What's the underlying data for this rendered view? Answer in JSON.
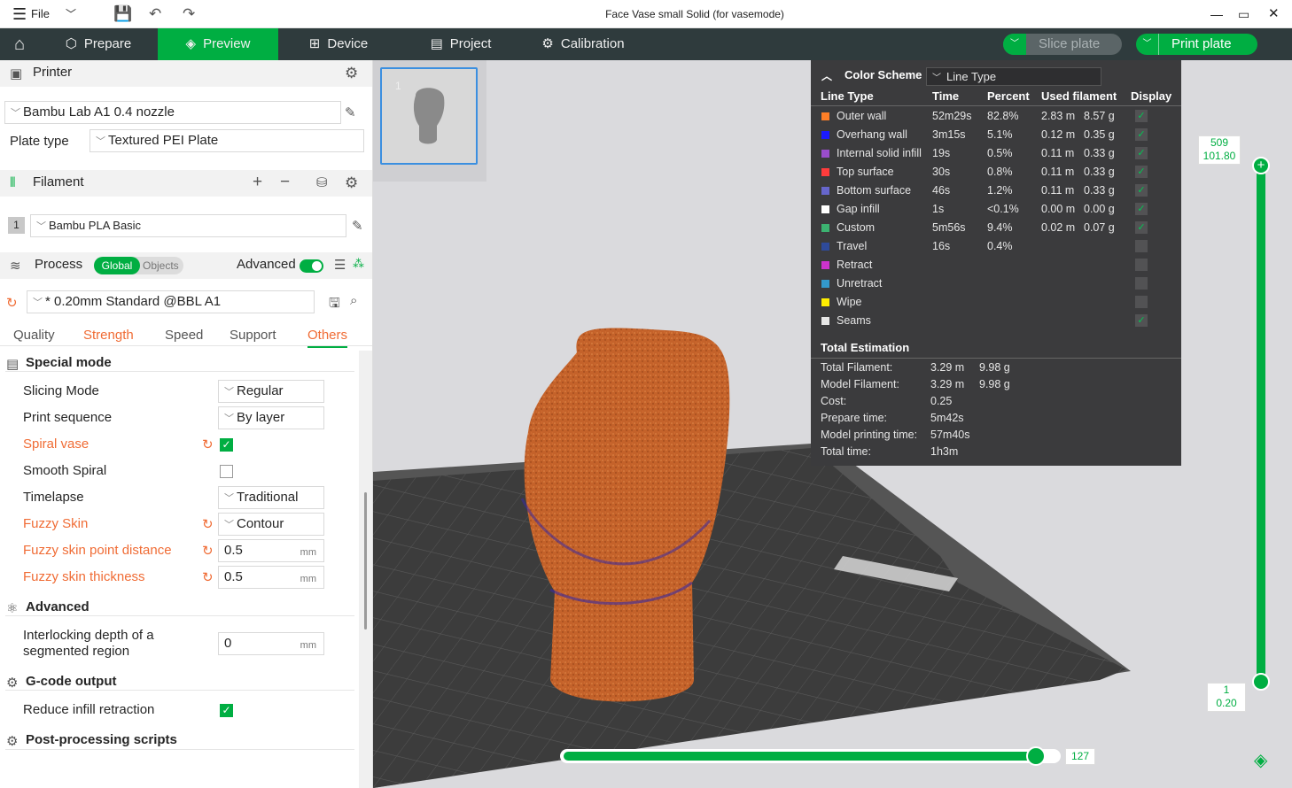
{
  "titlebar": {
    "title": "Face Vase small Solid (for vasemode)",
    "file_label": "File",
    "icons": [
      "menu-icon",
      "chevron-down-icon",
      "save-icon",
      "undo-icon",
      "redo-icon",
      "minimize-icon",
      "maximize-icon",
      "close-icon"
    ]
  },
  "nav": {
    "tabs": [
      {
        "label": "Prepare",
        "icon": "cube-icon"
      },
      {
        "label": "Preview",
        "icon": "layers-icon"
      },
      {
        "label": "Device",
        "icon": "device-icon"
      },
      {
        "label": "Project",
        "icon": "project-icon"
      },
      {
        "label": "Calibration",
        "icon": "calibration-icon"
      }
    ],
    "active_tab": "Preview",
    "slice_label": "Slice plate",
    "print_label": "Print plate"
  },
  "printer": {
    "section_label": "Printer",
    "name": "Bambu Lab A1 0.4 nozzle",
    "plate_type_label": "Plate type",
    "plate_type": "Textured PEI Plate"
  },
  "filament": {
    "section_label": "Filament",
    "slot": "1",
    "name": "Bambu PLA Basic"
  },
  "process": {
    "section_label": "Process",
    "toggle_global": "Global",
    "toggle_objects": "Objects",
    "advanced_label": "Advanced",
    "preset": "* 0.20mm Standard @BBL A1",
    "tabs": [
      "Quality",
      "Strength",
      "Speed",
      "Support",
      "Others"
    ],
    "active_tab": "Others"
  },
  "settings": {
    "special_mode": "Special mode",
    "slicing_mode_label": "Slicing Mode",
    "slicing_mode": "Regular",
    "print_sequence_label": "Print sequence",
    "print_sequence": "By layer",
    "spiral_vase_label": "Spiral vase",
    "smooth_spiral_label": "Smooth Spiral",
    "timelapse_label": "Timelapse",
    "timelapse": "Traditional",
    "fuzzy_skin_label": "Fuzzy Skin",
    "fuzzy_skin": "Contour",
    "fuzzy_point_label": "Fuzzy skin point distance",
    "fuzzy_point": "0.5",
    "fuzzy_thick_label": "Fuzzy skin thickness",
    "fuzzy_thick": "0.5",
    "unit_mm": "mm",
    "advanced": "Advanced",
    "interlock_label_1": "Interlocking depth of a",
    "interlock_label_2": "segmented region",
    "interlock": "0",
    "gcode_output": "G-code output",
    "reduce_retraction_label": "Reduce infill retraction",
    "post_processing": "Post-processing scripts"
  },
  "plate": {
    "number": "1"
  },
  "legend": {
    "color_scheme_label": "Color Scheme",
    "color_scheme": "Line Type",
    "headers": [
      "Line Type",
      "Time",
      "Percent",
      "Used filament",
      "Display"
    ],
    "rows": [
      {
        "name": "Outer wall",
        "time": "52m29s",
        "percent": "82.8%",
        "len": "2.83 m",
        "weight": "8.57 g",
        "color": "#ff7f27",
        "display": true
      },
      {
        "name": "Overhang wall",
        "time": "3m15s",
        "percent": "5.1%",
        "len": "0.12 m",
        "weight": "0.35 g",
        "color": "#1a1aff",
        "display": true
      },
      {
        "name": "Internal solid infill",
        "time": "19s",
        "percent": "0.5%",
        "len": "0.11 m",
        "weight": "0.33 g",
        "color": "#9a4dcc",
        "display": true
      },
      {
        "name": "Top surface",
        "time": "30s",
        "percent": "0.8%",
        "len": "0.11 m",
        "weight": "0.33 g",
        "color": "#ff3c3c",
        "display": true
      },
      {
        "name": "Bottom surface",
        "time": "46s",
        "percent": "1.2%",
        "len": "0.11 m",
        "weight": "0.33 g",
        "color": "#6666cc",
        "display": true
      },
      {
        "name": "Gap infill",
        "time": "1s",
        "percent": "<0.1%",
        "len": "0.00 m",
        "weight": "0.00 g",
        "color": "#ffffff",
        "display": true
      },
      {
        "name": "Custom",
        "time": "5m56s",
        "percent": "9.4%",
        "len": "0.02 m",
        "weight": "0.07 g",
        "color": "#3cb371",
        "display": true
      },
      {
        "name": "Travel",
        "time": "16s",
        "percent": "0.4%",
        "len": "",
        "weight": "",
        "color": "#2e4a9a",
        "display": false
      },
      {
        "name": "Retract",
        "time": "",
        "percent": "",
        "len": "",
        "weight": "",
        "color": "#cc33cc",
        "display": false
      },
      {
        "name": "Unretract",
        "time": "",
        "percent": "",
        "len": "",
        "weight": "",
        "color": "#3399cc",
        "display": false
      },
      {
        "name": "Wipe",
        "time": "",
        "percent": "",
        "len": "",
        "weight": "",
        "color": "#ffee00",
        "display": false
      },
      {
        "name": "Seams",
        "time": "",
        "percent": "",
        "len": "",
        "weight": "",
        "color": "#e6e6e6",
        "display": true
      }
    ],
    "total_label": "Total Estimation",
    "totals": [
      {
        "label": "Total Filament:",
        "v1": "3.29 m",
        "v2": "9.98 g"
      },
      {
        "label": "Model Filament:",
        "v1": "3.29 m",
        "v2": "9.98 g"
      },
      {
        "label": "Cost:",
        "v1": "0.25",
        "v2": ""
      },
      {
        "label": "Prepare time:",
        "v1": "5m42s",
        "v2": ""
      },
      {
        "label": "Model printing time:",
        "v1": "57m40s",
        "v2": ""
      },
      {
        "label": "Total time:",
        "v1": "1h3m",
        "v2": ""
      }
    ]
  },
  "layer_slider": {
    "top_layer": "509",
    "top_height": "101.80",
    "bottom_layer": "1",
    "bottom_height": "0.20"
  },
  "move_slider": {
    "value": "127",
    "fraction": 0.95
  },
  "colors": {
    "accent": "#00ae42",
    "nav_bg": "#2f3b3d",
    "orange": "#f06c35",
    "model": "#c4622a"
  }
}
